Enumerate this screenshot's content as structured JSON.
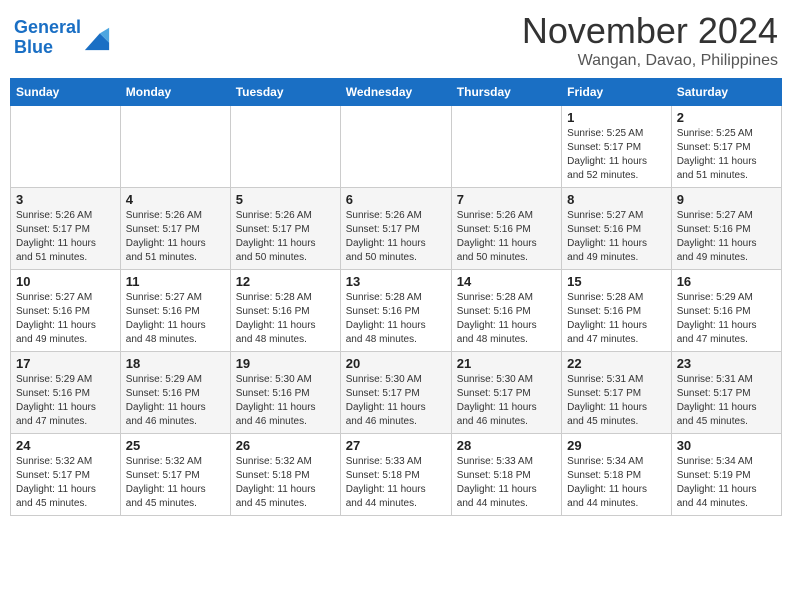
{
  "header": {
    "logo_line1": "General",
    "logo_line2": "Blue",
    "month_title": "November 2024",
    "location": "Wangan, Davao, Philippines"
  },
  "days_of_week": [
    "Sunday",
    "Monday",
    "Tuesday",
    "Wednesday",
    "Thursday",
    "Friday",
    "Saturday"
  ],
  "weeks": [
    [
      {
        "day": "",
        "info": ""
      },
      {
        "day": "",
        "info": ""
      },
      {
        "day": "",
        "info": ""
      },
      {
        "day": "",
        "info": ""
      },
      {
        "day": "",
        "info": ""
      },
      {
        "day": "1",
        "info": "Sunrise: 5:25 AM\nSunset: 5:17 PM\nDaylight: 11 hours\nand 52 minutes."
      },
      {
        "day": "2",
        "info": "Sunrise: 5:25 AM\nSunset: 5:17 PM\nDaylight: 11 hours\nand 51 minutes."
      }
    ],
    [
      {
        "day": "3",
        "info": "Sunrise: 5:26 AM\nSunset: 5:17 PM\nDaylight: 11 hours\nand 51 minutes."
      },
      {
        "day": "4",
        "info": "Sunrise: 5:26 AM\nSunset: 5:17 PM\nDaylight: 11 hours\nand 51 minutes."
      },
      {
        "day": "5",
        "info": "Sunrise: 5:26 AM\nSunset: 5:17 PM\nDaylight: 11 hours\nand 50 minutes."
      },
      {
        "day": "6",
        "info": "Sunrise: 5:26 AM\nSunset: 5:17 PM\nDaylight: 11 hours\nand 50 minutes."
      },
      {
        "day": "7",
        "info": "Sunrise: 5:26 AM\nSunset: 5:16 PM\nDaylight: 11 hours\nand 50 minutes."
      },
      {
        "day": "8",
        "info": "Sunrise: 5:27 AM\nSunset: 5:16 PM\nDaylight: 11 hours\nand 49 minutes."
      },
      {
        "day": "9",
        "info": "Sunrise: 5:27 AM\nSunset: 5:16 PM\nDaylight: 11 hours\nand 49 minutes."
      }
    ],
    [
      {
        "day": "10",
        "info": "Sunrise: 5:27 AM\nSunset: 5:16 PM\nDaylight: 11 hours\nand 49 minutes."
      },
      {
        "day": "11",
        "info": "Sunrise: 5:27 AM\nSunset: 5:16 PM\nDaylight: 11 hours\nand 48 minutes."
      },
      {
        "day": "12",
        "info": "Sunrise: 5:28 AM\nSunset: 5:16 PM\nDaylight: 11 hours\nand 48 minutes."
      },
      {
        "day": "13",
        "info": "Sunrise: 5:28 AM\nSunset: 5:16 PM\nDaylight: 11 hours\nand 48 minutes."
      },
      {
        "day": "14",
        "info": "Sunrise: 5:28 AM\nSunset: 5:16 PM\nDaylight: 11 hours\nand 48 minutes."
      },
      {
        "day": "15",
        "info": "Sunrise: 5:28 AM\nSunset: 5:16 PM\nDaylight: 11 hours\nand 47 minutes."
      },
      {
        "day": "16",
        "info": "Sunrise: 5:29 AM\nSunset: 5:16 PM\nDaylight: 11 hours\nand 47 minutes."
      }
    ],
    [
      {
        "day": "17",
        "info": "Sunrise: 5:29 AM\nSunset: 5:16 PM\nDaylight: 11 hours\nand 47 minutes."
      },
      {
        "day": "18",
        "info": "Sunrise: 5:29 AM\nSunset: 5:16 PM\nDaylight: 11 hours\nand 46 minutes."
      },
      {
        "day": "19",
        "info": "Sunrise: 5:30 AM\nSunset: 5:16 PM\nDaylight: 11 hours\nand 46 minutes."
      },
      {
        "day": "20",
        "info": "Sunrise: 5:30 AM\nSunset: 5:17 PM\nDaylight: 11 hours\nand 46 minutes."
      },
      {
        "day": "21",
        "info": "Sunrise: 5:30 AM\nSunset: 5:17 PM\nDaylight: 11 hours\nand 46 minutes."
      },
      {
        "day": "22",
        "info": "Sunrise: 5:31 AM\nSunset: 5:17 PM\nDaylight: 11 hours\nand 45 minutes."
      },
      {
        "day": "23",
        "info": "Sunrise: 5:31 AM\nSunset: 5:17 PM\nDaylight: 11 hours\nand 45 minutes."
      }
    ],
    [
      {
        "day": "24",
        "info": "Sunrise: 5:32 AM\nSunset: 5:17 PM\nDaylight: 11 hours\nand 45 minutes."
      },
      {
        "day": "25",
        "info": "Sunrise: 5:32 AM\nSunset: 5:17 PM\nDaylight: 11 hours\nand 45 minutes."
      },
      {
        "day": "26",
        "info": "Sunrise: 5:32 AM\nSunset: 5:18 PM\nDaylight: 11 hours\nand 45 minutes."
      },
      {
        "day": "27",
        "info": "Sunrise: 5:33 AM\nSunset: 5:18 PM\nDaylight: 11 hours\nand 44 minutes."
      },
      {
        "day": "28",
        "info": "Sunrise: 5:33 AM\nSunset: 5:18 PM\nDaylight: 11 hours\nand 44 minutes."
      },
      {
        "day": "29",
        "info": "Sunrise: 5:34 AM\nSunset: 5:18 PM\nDaylight: 11 hours\nand 44 minutes."
      },
      {
        "day": "30",
        "info": "Sunrise: 5:34 AM\nSunset: 5:19 PM\nDaylight: 11 hours\nand 44 minutes."
      }
    ]
  ]
}
